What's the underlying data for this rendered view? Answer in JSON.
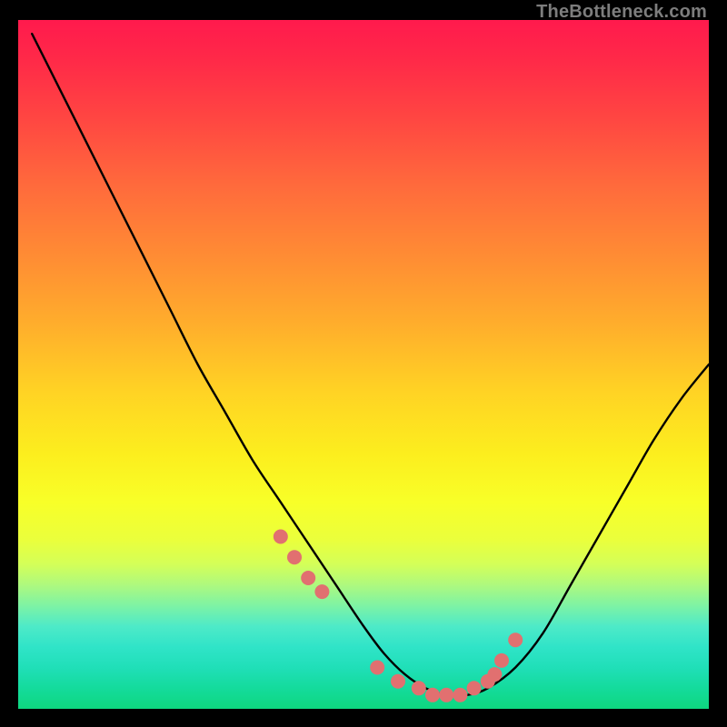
{
  "watermark": "TheBottleneck.com",
  "colors": {
    "background": "#000000",
    "dot": "#e17070",
    "curve": "#000000",
    "watermark": "#7d7d7d"
  },
  "chart_data": {
    "type": "line",
    "title": "",
    "xlabel": "",
    "ylabel": "",
    "x_range": [
      0,
      100
    ],
    "y_range": [
      0,
      100
    ],
    "series": [
      {
        "name": "bottleneck-curve",
        "x": [
          2,
          6,
          10,
          14,
          18,
          22,
          26,
          30,
          34,
          38,
          42,
          46,
          50,
          53,
          56,
          59,
          62,
          65,
          68,
          72,
          76,
          80,
          84,
          88,
          92,
          96,
          100
        ],
        "y": [
          98,
          90,
          82,
          74,
          66,
          58,
          50,
          43,
          36,
          30,
          24,
          18,
          12,
          8,
          5,
          3,
          2,
          2,
          3,
          6,
          11,
          18,
          25,
          32,
          39,
          45,
          50
        ]
      }
    ],
    "markers": {
      "name": "highlight-dots",
      "x": [
        38,
        40,
        42,
        44,
        52,
        55,
        58,
        60,
        62,
        64,
        66,
        68,
        69,
        70,
        72
      ],
      "y": [
        25,
        22,
        19,
        17,
        6,
        4,
        3,
        2,
        2,
        2,
        3,
        4,
        5,
        7,
        10
      ]
    }
  }
}
